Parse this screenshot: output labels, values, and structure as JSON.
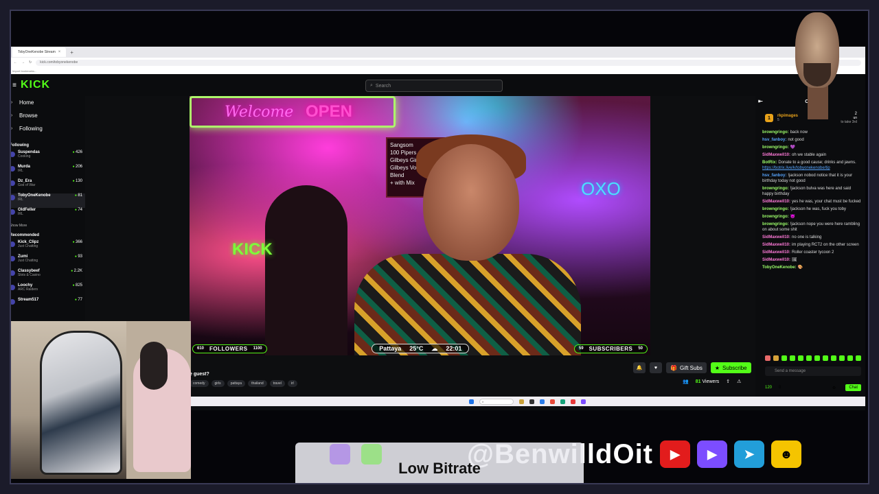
{
  "browser": {
    "tab_title": "TobyOneKenobe Stream",
    "tab_close": "×",
    "new_tab": "+",
    "url": "kick.com/tobyonekenobe",
    "bookmarks": "Import bookmarks..."
  },
  "kick": {
    "logo": "KICK",
    "search_placeholder": "Search"
  },
  "sidebar": {
    "nav": [
      {
        "label": "Home",
        "icon": "home-icon"
      },
      {
        "label": "Browse",
        "icon": "browse-icon"
      },
      {
        "label": "Following",
        "icon": "heart-icon"
      }
    ],
    "following_title": "Following",
    "following": [
      {
        "name": "Suspendas",
        "category": "Cooking",
        "viewers": "426"
      },
      {
        "name": "Murda",
        "category": "IRL",
        "viewers": "206"
      },
      {
        "name": "Dz_Era",
        "category": "God of War",
        "viewers": "130"
      },
      {
        "name": "TobyOneKenobe",
        "category": "IRL",
        "viewers": "81"
      },
      {
        "name": "OldFeller",
        "category": "IRL",
        "viewers": "74"
      }
    ],
    "show_more": "Show More",
    "recommended_title": "Recommended",
    "recommended": [
      {
        "name": "Kick_Clipz",
        "category": "Just Chatting",
        "viewers": "366"
      },
      {
        "name": "Zumi",
        "category": "Just Chatting",
        "viewers": "93"
      },
      {
        "name": "Classybeef",
        "category": "Slots & Casino",
        "viewers": "2.2K"
      },
      {
        "name": "Loochy",
        "category": "ARC Raiders",
        "viewers": "825"
      },
      {
        "name": "Stream517",
        "category": "",
        "viewers": "77"
      }
    ]
  },
  "player": {
    "sign_welcome": "Welcome",
    "sign_open": "OPEN",
    "menu": [
      "Sangsom",
      "100 Pipers",
      "Gilbeys Gin",
      "Gilbeys Vodka",
      "Blend",
      "+ with Mix"
    ],
    "kick_neon": "KICK",
    "oxo": "OXO",
    "overlay": {
      "followers_count": "610",
      "followers_label": "FOLLOWERS",
      "followers_goal": "1100",
      "location": "Pattaya",
      "temperature": "25°C",
      "weather_icon": "cloud-icon",
      "time": "22:01",
      "subs_count": "59",
      "subs_label": "SUBSCRIBERS",
      "subs_goal": "50"
    }
  },
  "stream": {
    "title": "e guest?",
    "tags": [
      "comedy",
      "girls",
      "pattaya",
      "thailand",
      "travel",
      "irl"
    ],
    "gift_label": "Gift Subs",
    "subscribe_label": "Subscribe",
    "viewers": "81",
    "viewers_label": "Viewers"
  },
  "chat": {
    "title": "Chat",
    "pinned_user": "rkpimages",
    "pinned_badge": "1",
    "pinned_count": "5",
    "pinned_right": "2",
    "pinned_text": "un",
    "pinned_sub": "to take 3rd",
    "messages": [
      {
        "user": "browngringo:",
        "color": "green",
        "text": "back now"
      },
      {
        "user": "hsv_fanboy:",
        "color": "blue",
        "text": "not good"
      },
      {
        "user": "browngringo:",
        "color": "green",
        "text": "💜"
      },
      {
        "user": "SidMaxwell10:",
        "color": "pink",
        "text": "oh we stable again"
      },
      {
        "user": "BotRix:",
        "color": "green",
        "text": "Donate to a good cause; drinks and jawns.",
        "link": "https://botrix.live/k/tobyonekenobe/tip"
      },
      {
        "user": "hsv_fanboy:",
        "color": "blue",
        "text": "!jackson nobod notice that it is your birthday today not good"
      },
      {
        "user": "browngringo:",
        "color": "green",
        "text": "!jackson bulva was here and said happy birthday"
      },
      {
        "user": "SidMaxwell10:",
        "color": "pink",
        "text": "yes he was, your chat must be fucked"
      },
      {
        "user": "browngringo:",
        "color": "green",
        "text": "!jackson he was, fuck you toby"
      },
      {
        "user": "browngringo:",
        "color": "green",
        "text": "😈"
      },
      {
        "user": "browngringo:",
        "color": "green",
        "text": "!jackson nope you were here rambling on about some shit"
      },
      {
        "user": "SidMaxwell10:",
        "color": "pink",
        "text": "no one is talking"
      },
      {
        "user": "SidMaxwell10:",
        "color": "pink",
        "text": "im playing RCT2 on the other screen"
      },
      {
        "user": "SidMaxwell10:",
        "color": "pink",
        "text": "Roller coaster tycoon 2"
      },
      {
        "user": "SidMaxwell10:",
        "color": "pink",
        "text": "🖼"
      },
      {
        "user": "TobyOneKenobe:",
        "color": "green",
        "text": "🎨"
      }
    ],
    "input_placeholder": "Send a message",
    "points": "120",
    "gift_count": "0",
    "chat_button": "Chat"
  },
  "overlay": {
    "handle": "@BenwilldOit",
    "low_bitrate": "Low Bitrate"
  },
  "colors": {
    "kick_green": "#53fc18",
    "chat_bg": "#0b0c0e",
    "youtube_red": "#e21c1c",
    "rumble_purple": "#7c4dff",
    "telegram_blue": "#229ed9"
  }
}
